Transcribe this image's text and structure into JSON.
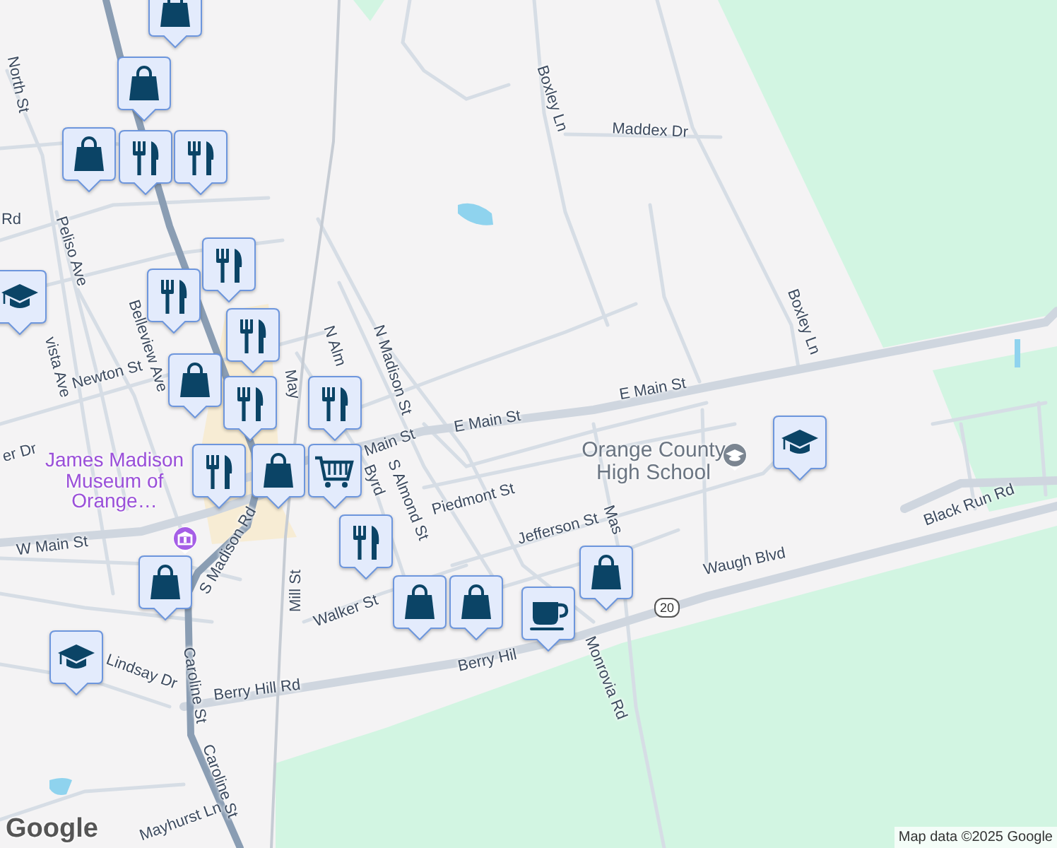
{
  "map": {
    "street_labels": [
      {
        "text": "North St"
      },
      {
        "text": "Rd"
      },
      {
        "text": "Peliso Ave"
      },
      {
        "text": "vista Ave"
      },
      {
        "text": "Newton St"
      },
      {
        "text": "Belleview Ave"
      },
      {
        "text": "May"
      },
      {
        "text": "N Alm"
      },
      {
        "text": "N Madison St"
      },
      {
        "text": "E Main St"
      },
      {
        "text": "E Main St"
      },
      {
        "text": "Boxley Ln"
      },
      {
        "text": "Maddex Dr"
      },
      {
        "text": "Boxley Ln"
      },
      {
        "text": "er Dr"
      },
      {
        "text": "Main St"
      },
      {
        "text": "S Almond St"
      },
      {
        "text": "Piedmont St"
      },
      {
        "text": "Byrd"
      },
      {
        "text": "W Main St"
      },
      {
        "text": "S Madison Rd"
      },
      {
        "text": "Mill St"
      },
      {
        "text": "Walker St"
      },
      {
        "text": "Jefferson St"
      },
      {
        "text": "Mas"
      },
      {
        "text": "Caroline St"
      },
      {
        "text": "Lindsay Dr"
      },
      {
        "text": "Berry Hill Rd"
      },
      {
        "text": "Berry Hil"
      },
      {
        "text": "Caroline St"
      },
      {
        "text": "Mayhurst Ln"
      },
      {
        "text": "Monrovia Rd"
      },
      {
        "text": "Waugh Blvd"
      },
      {
        "text": "Black Run Rd"
      }
    ],
    "places": [
      {
        "name": "James Madison Museum of Orange…",
        "kind": "museum"
      },
      {
        "name": "Orange County High School",
        "kind": "school"
      }
    ],
    "route_shield": "20",
    "markers": [
      {
        "kind": "shopping"
      },
      {
        "kind": "shopping"
      },
      {
        "kind": "shopping"
      },
      {
        "kind": "restaurant"
      },
      {
        "kind": "restaurant"
      },
      {
        "kind": "school"
      },
      {
        "kind": "restaurant"
      },
      {
        "kind": "restaurant"
      },
      {
        "kind": "restaurant"
      },
      {
        "kind": "restaurant"
      },
      {
        "kind": "shopping"
      },
      {
        "kind": "restaurant"
      },
      {
        "kind": "restaurant"
      },
      {
        "kind": "shopping"
      },
      {
        "kind": "grocery"
      },
      {
        "kind": "restaurant"
      },
      {
        "kind": "shopping"
      },
      {
        "kind": "school"
      },
      {
        "kind": "shopping"
      },
      {
        "kind": "shopping"
      },
      {
        "kind": "cafe"
      },
      {
        "kind": "shopping"
      },
      {
        "kind": "school"
      }
    ],
    "logo": "Google",
    "attribution": "Map data ©2025 Google"
  }
}
